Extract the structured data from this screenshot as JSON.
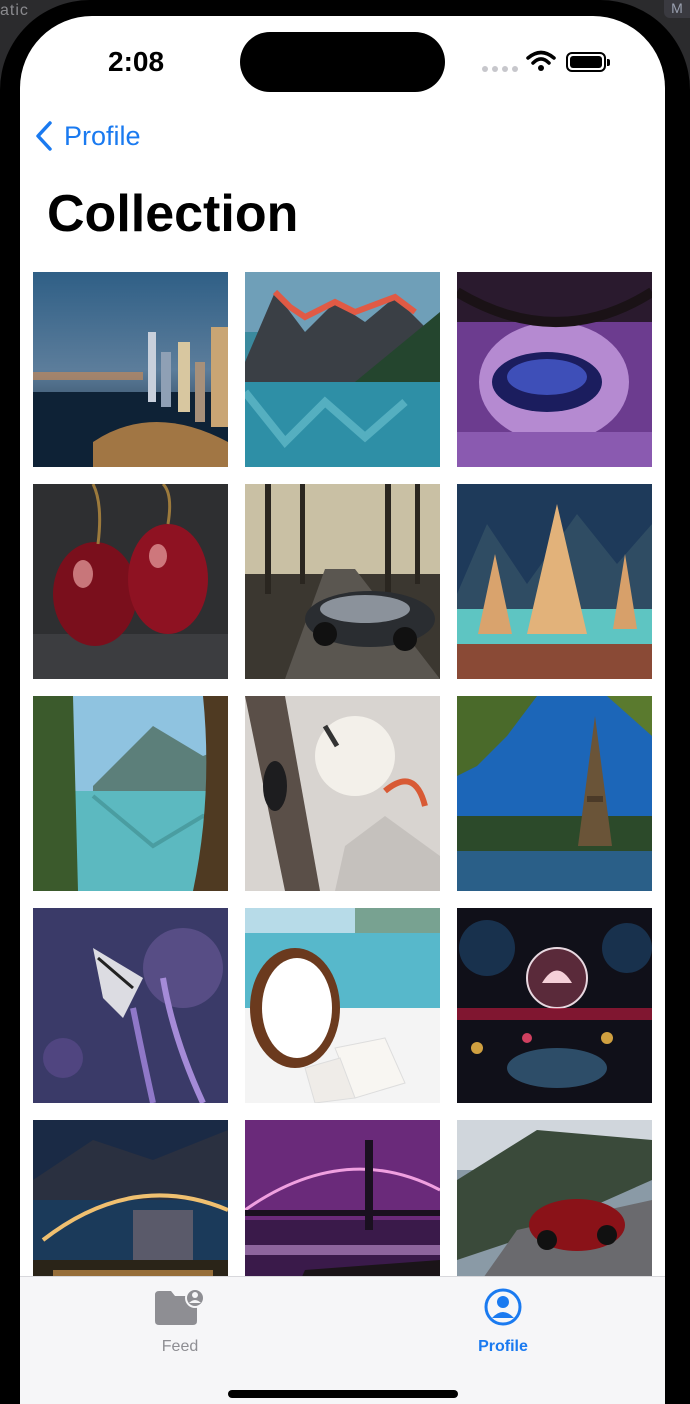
{
  "background": {
    "window_text": "atic",
    "badge": "M"
  },
  "status_bar": {
    "time": "2:08"
  },
  "nav": {
    "back_label": "Profile",
    "title": "Collection"
  },
  "grid": {
    "items": [
      "city-skyline-night-photo",
      "mountain-lake-reflection-photo",
      "purple-tree-lake-photo",
      "red-cherries-photo",
      "sports-car-forest-road-photo",
      "christmas-trees-snow-photo",
      "turquoise-lake-valley-photo",
      "skydiving-paraglider-photo",
      "eiffel-tower-river-photo",
      "butterfly-lavender-photo",
      "coconut-beach-photo",
      "lotus-bubbles-art-photo",
      "bridge-city-night-photo",
      "purple-bridge-night-photo",
      "red-car-mountain-road-photo"
    ]
  },
  "tab_bar": {
    "tabs": [
      {
        "label": "Feed",
        "icon": "folder-person-icon",
        "active": false
      },
      {
        "label": "Profile",
        "icon": "person-circle-icon",
        "active": true
      }
    ]
  },
  "colors": {
    "accent": "#1a7af0",
    "inactive": "#8e8e93"
  }
}
